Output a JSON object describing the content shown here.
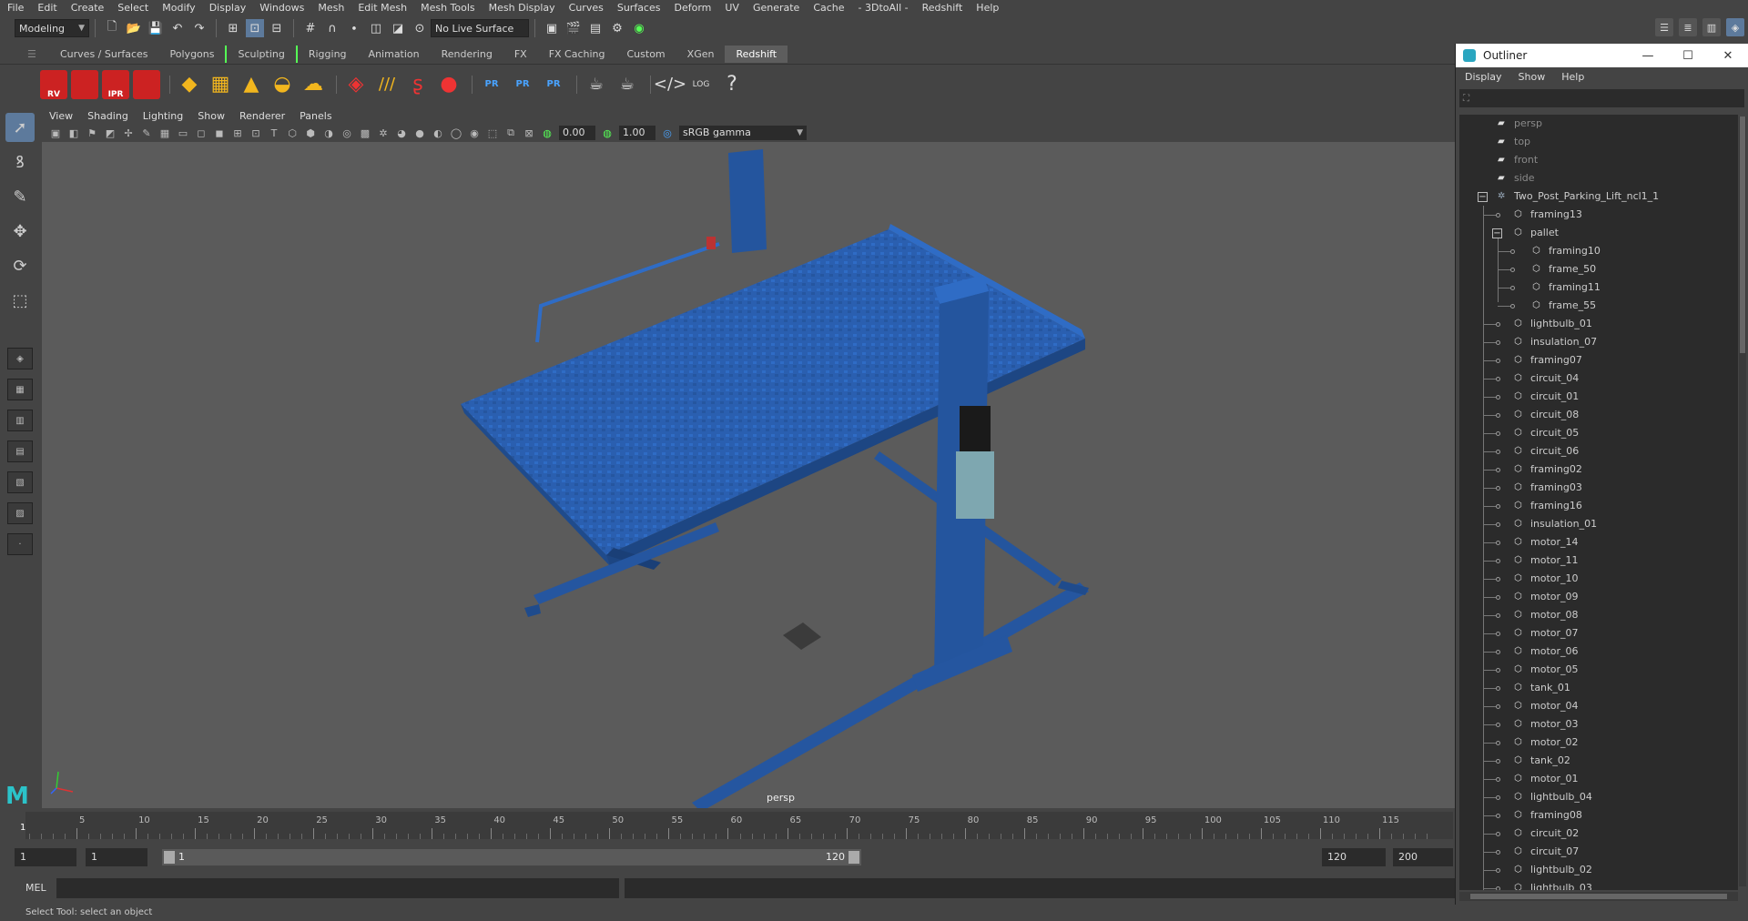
{
  "menubar": {
    "items": [
      "File",
      "Edit",
      "Create",
      "Select",
      "Modify",
      "Display",
      "Windows",
      "Mesh",
      "Edit Mesh",
      "Mesh Tools",
      "Mesh Display",
      "Curves",
      "Surfaces",
      "Deform",
      "UV",
      "Generate",
      "Cache",
      "- 3DtoAll -",
      "Redshift",
      "Help"
    ]
  },
  "statusline": {
    "mode": "Modeling",
    "live_surface": "No Live Surface"
  },
  "shelf_tabs": {
    "tabs": [
      "Curves / Surfaces",
      "Polygons",
      "Sculpting",
      "Rigging",
      "Animation",
      "Rendering",
      "FX",
      "FX Caching",
      "Custom",
      "XGen",
      "Redshift"
    ],
    "active": "Redshift"
  },
  "shelf": {
    "rs_labels": [
      "RV",
      "",
      "IPR",
      ""
    ],
    "pr_labels": [
      "PR",
      "PR",
      "PR"
    ],
    "log_label": "LOG"
  },
  "viewport": {
    "menu": [
      "View",
      "Shading",
      "Lighting",
      "Show",
      "Renderer",
      "Panels"
    ],
    "exposure": "0.00",
    "gamma_value": "1.00",
    "color_space": "sRGB gamma",
    "camera_label": "persp"
  },
  "timeline": {
    "ticks": [
      5,
      10,
      15,
      20,
      25,
      30,
      35,
      40,
      45,
      50,
      55,
      60,
      65,
      70,
      75,
      80,
      85,
      90,
      95,
      100,
      105,
      110,
      115
    ],
    "current_frame": "1"
  },
  "range": {
    "start": "1",
    "playback_start": "1",
    "bar_start": "1",
    "bar_end": "120",
    "playback_end": "120",
    "end": "200"
  },
  "cmdline": {
    "label": "MEL"
  },
  "helpline": {
    "text": "Select Tool: select an object"
  },
  "outliner": {
    "title": "Outliner",
    "menu": [
      "Display",
      "Show",
      "Help"
    ],
    "cameras": [
      "persp",
      "top",
      "front",
      "side"
    ],
    "root": "Two_Post_Parking_Lift_ncl1_1",
    "group": "pallet",
    "group_children": [
      "framing10",
      "frame_50",
      "framing11",
      "frame_55"
    ],
    "items_before_group": [
      "framing13"
    ],
    "items_after_group": [
      "lightbulb_01",
      "insulation_07",
      "framing07",
      "circuit_04",
      "circuit_01",
      "circuit_08",
      "circuit_05",
      "circuit_06",
      "framing02",
      "framing03",
      "framing16",
      "insulation_01",
      "motor_14",
      "motor_11",
      "motor_10",
      "motor_09",
      "motor_08",
      "motor_07",
      "motor_06",
      "motor_05",
      "tank_01",
      "motor_04",
      "motor_03",
      "motor_02",
      "tank_02",
      "motor_01",
      "lightbulb_04",
      "framing08",
      "circuit_02",
      "circuit_07",
      "lightbulb_02",
      "lightbulb_03"
    ]
  }
}
